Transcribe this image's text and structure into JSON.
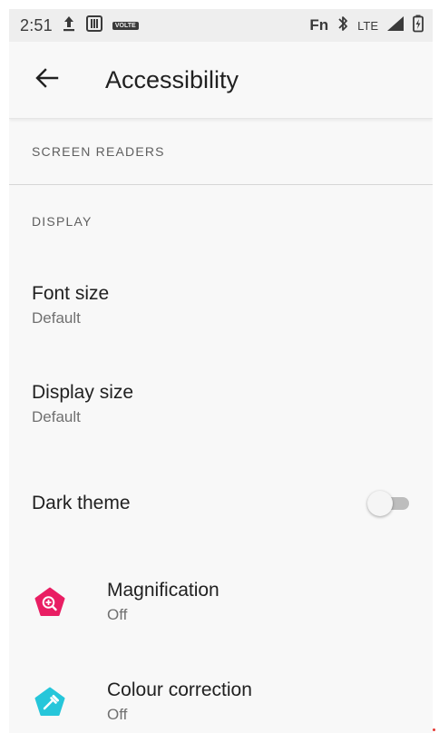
{
  "status_bar": {
    "time": "2:51",
    "volte": "VOLTE",
    "fn": "Fn",
    "network": "LTE"
  },
  "app_bar": {
    "title": "Accessibility"
  },
  "sections": {
    "screen_readers": "SCREEN READERS",
    "display": "DISPLAY"
  },
  "items": {
    "font_size": {
      "title": "Font size",
      "summary": "Default"
    },
    "display_size": {
      "title": "Display size",
      "summary": "Default"
    },
    "dark_theme": {
      "title": "Dark theme",
      "enabled": false
    },
    "magnification": {
      "title": "Magnification",
      "summary": "Off"
    },
    "colour_correction": {
      "title": "Colour correction",
      "summary": "Off"
    }
  },
  "colors": {
    "magnification_icon": "#e91e63",
    "colour_correction_icon": "#26c6da",
    "toggle_off_track": "#bdbdbd",
    "background": "#f8f8f8"
  }
}
